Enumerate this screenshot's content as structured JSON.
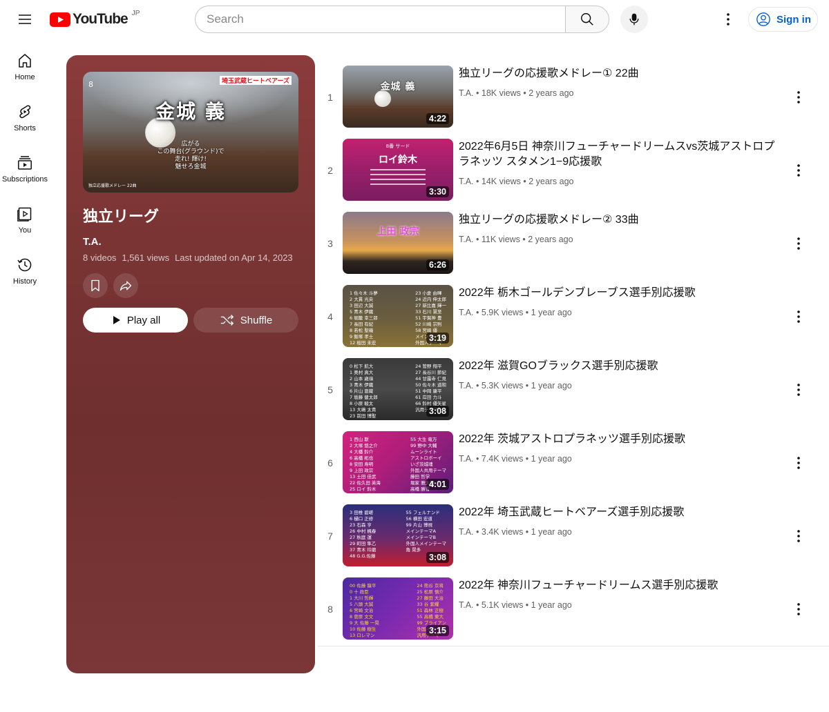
{
  "header": {
    "logo_text": "YouTube",
    "region": "JP",
    "search_placeholder": "Search",
    "signin_label": "Sign in"
  },
  "nav": [
    {
      "label": "Home",
      "icon": "home-icon"
    },
    {
      "label": "Shorts",
      "icon": "shorts-icon"
    },
    {
      "label": "Subscriptions",
      "icon": "subscriptions-icon"
    },
    {
      "label": "You",
      "icon": "you-icon"
    },
    {
      "label": "History",
      "icon": "history-icon"
    }
  ],
  "playlist": {
    "title": "独立リーグ",
    "owner": "T.A.",
    "video_count": "8 videos",
    "views": "1,561 views",
    "updated": "Last updated on Apr 14, 2023",
    "play_all_label": "Play all",
    "shuffle_label": "Shuffle",
    "thumb_team": "埼玉武蔵ヒートベアーズ",
    "thumb_name": "金城 義",
    "thumb_lyrics": "広がる / この舞台(グラウンド)で / 走れ! 輝け! / 魅せろ金城",
    "thumb_caption": "独立応援歌メドレー 22曲",
    "thumb_number": "8",
    "panel_color": "#7a3434"
  },
  "videos": [
    {
      "index": "1",
      "title": "独立リーグの応援歌メドレー① 22曲",
      "channel": "T.A.",
      "views": "18K views",
      "age": "2 years ago",
      "duration": "4:22"
    },
    {
      "index": "2",
      "title": "2022年6月5日 神奈川フューチャードリームスvs茨城アストロプラネッツ スタメン1−9応援歌",
      "channel": "T.A.",
      "views": "14K views",
      "age": "2 years ago",
      "duration": "3:30"
    },
    {
      "index": "3",
      "title": "独立リーグの応援歌メドレー② 33曲",
      "channel": "T.A.",
      "views": "11K views",
      "age": "2 years ago",
      "duration": "6:26"
    },
    {
      "index": "4",
      "title": "2022年 栃木ゴールデンブレーブス選手別応援歌",
      "channel": "T.A.",
      "views": "5.9K views",
      "age": "1 year ago",
      "duration": "3:19"
    },
    {
      "index": "5",
      "title": "2022年 滋賀GOブラックス選手別応援歌",
      "channel": "T.A.",
      "views": "5.3K views",
      "age": "1 year ago",
      "duration": "3:08"
    },
    {
      "index": "6",
      "title": "2022年 茨城アストロプラネッツ選手別応援歌",
      "channel": "T.A.",
      "views": "7.4K views",
      "age": "1 year ago",
      "duration": "4:01"
    },
    {
      "index": "7",
      "title": "2022年 埼玉武蔵ヒートベアーズ選手別応援歌",
      "channel": "T.A.",
      "views": "3.4K views",
      "age": "1 year ago",
      "duration": "3:08"
    },
    {
      "index": "8",
      "title": "2022年 神奈川フューチャードリームス選手別応援歌",
      "channel": "T.A.",
      "views": "5.1K views",
      "age": "1 year ago",
      "duration": "3:15"
    }
  ],
  "thumb_text": {
    "v1_name": "金城 義",
    "v2_header": "8番 サード",
    "v2_name": "ロイ鈴木",
    "v3_name": "上田 政宗",
    "v4_left": "1 佐々木 斗夢\n2 大貫 光央\n3 田辺 大誠\n5 青木 伊織\n6 堀籠 幸三郎\n7 長田 有紀\n8 若松 聖磯\n9 飯塚 孝士\n12 桜田 未宏\n13 谷田部 翔太",
    "v4_right": "23 小倉 由暉\n24 近内 伸太郎\n27 新比嘉 輝一\n33 石川 慧至\n51 宇賀神 豊\n52 川崎 宗則\n58 宮崎 優\nメインテーマ\n外国人テーマ",
    "v5_left": "0 松下 航大\n1 奥村 真大\n2 山本 歳嶺\n3 青木 伊織\n6 片山 恩蔵\n7 坂藤 健太郎\n8 小原 駿太\n13 大嶋 太貴\n23 前田 博聖",
    "v5_right": "24 管野 翔平\n27 長谷川 節紀\n44 甘露寺 仁見\n50 佐々木 道和\n51 中岡 康平\n61 岸田 力斗\n66 鈴村 優矢星\n汎用テーマ",
    "v6_left": "1 西山 斯\n2 大塚 悠之介\n4 大橋 鈴介\n6 高橋 柘也\n8 安田 寿明\n9 上田 政宗\n13 土田 佳武\n22 佐久田 英海\n25 ロイ 鈴木\n51 瀬上 蒼太",
    "v6_right": "55 大生 竜万\n99 野中 大輔\nムーンライト\nアストロボーイ\nいざ茨城魂\n外国人共用テーマ\n藤田 哲学\n堀家 雅太朗\n高橋 勝雪\n横田 拓",
    "v7_left": "3 田椎 碧嵯\n6 樋口 正修\n23 石森 亨\n26 中村 楓春\n27 秋庭 運\n29 町田 隼乙\n37 青木 玲磨\n48 G.G.佐藤",
    "v7_right": "55 フェルナンド\n56 横田 宏道\n99 片山 博視\nメインテーマA\nメインテーマB\n外国人メインテーマ\n角 晃多",
    "v8_left": "00 佐藤 龍平\n0 十 政臣\n1 大川 哲輝\n5 八頭 大誠\n6 宮崎 文治\n8 菅原 文文\n9 大 佐藤 一晃\n10 佐藤 樹生\n13 ロレマン",
    "v8_right": "24 熊谷 京将\n25 松原 慎介\n27 藤田 大治\n33 谷 紫耀\n51 森林 正樹\n55 高橋 東大\n99 ブライアン\n外国人テーマ\n汎用テーマ"
  },
  "colors": {
    "accent_red": "#ff0000",
    "link_blue": "#065fd4",
    "meta_gray": "#606060"
  }
}
